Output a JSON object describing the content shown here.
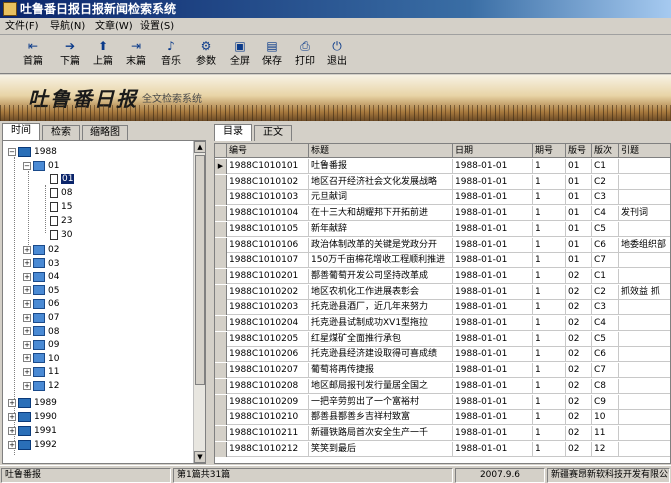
{
  "window": {
    "title": "吐鲁番日报日报新闻检索系统"
  },
  "menu": [
    "文件(F)",
    "导航(N)",
    "文章(W)",
    "设置(S)"
  ],
  "toolbar": [
    {
      "label": "首篇",
      "icon": "first-article-icon",
      "glyph": "⇤"
    },
    {
      "label": "下篇",
      "icon": "next-article-icon",
      "glyph": "➔"
    },
    {
      "label": "上篇",
      "icon": "prev-article-icon",
      "glyph": "⬆"
    },
    {
      "label": "末篇",
      "icon": "last-article-icon",
      "glyph": "⇥"
    },
    {
      "label": "音乐",
      "icon": "music-note-icon",
      "glyph": "♪"
    },
    {
      "label": "参数",
      "icon": "settings-icon",
      "glyph": "⚙"
    },
    {
      "label": "全屏",
      "icon": "fullscreen-icon",
      "glyph": "▣"
    },
    {
      "label": "保存",
      "icon": "save-disk-icon",
      "glyph": "▤"
    },
    {
      "label": "打印",
      "icon": "printer-icon",
      "glyph": "⎙"
    },
    {
      "label": "退出",
      "icon": "exit-icon",
      "glyph": "⏻"
    }
  ],
  "banner": {
    "logo": "吐鲁番日报",
    "subtitle": "全文检索系统"
  },
  "left_tabs": [
    "时间",
    "检索",
    "缩略图"
  ],
  "tree": {
    "year_open": "1988",
    "month_open": "01",
    "days": [
      "01",
      "08",
      "15",
      "23",
      "30"
    ],
    "months": [
      "02",
      "03",
      "04",
      "05",
      "06",
      "07",
      "08",
      "09",
      "10",
      "11",
      "12"
    ],
    "years": [
      "1989",
      "1990",
      "1991",
      "1992"
    ]
  },
  "right_tabs": [
    "目录",
    "正文"
  ],
  "grid": {
    "columns": [
      "编号",
      "标题",
      "日期",
      "期号",
      "版号",
      "版次",
      "引题"
    ],
    "rows": [
      [
        "1988C1010101",
        "吐鲁番报",
        "1988-01-01",
        "1",
        "01",
        "C1",
        ""
      ],
      [
        "1988C1010102",
        "地区召开经济社会文化发展战略",
        "1988-01-01",
        "1",
        "01",
        "C2",
        ""
      ],
      [
        "1988C1010103",
        "元旦献词",
        "1988-01-01",
        "1",
        "01",
        "C3",
        ""
      ],
      [
        "1988C1010104",
        "在十三大和胡耀邦下开拓前进",
        "1988-01-01",
        "1",
        "01",
        "C4",
        "发刊词"
      ],
      [
        "1988C1010105",
        "新年献辞",
        "1988-01-01",
        "1",
        "01",
        "C5",
        ""
      ],
      [
        "1988C1010106",
        "政治体制改革的关键是党政分开",
        "1988-01-01",
        "1",
        "01",
        "C6",
        "地委组织部"
      ],
      [
        "1988C1010107",
        "150万千亩棉花增收工程顺利推进",
        "1988-01-01",
        "1",
        "01",
        "C7",
        ""
      ],
      [
        "1988C1010201",
        "鄯善葡萄开发公司坚持改革成",
        "1988-01-01",
        "1",
        "02",
        "C1",
        ""
      ],
      [
        "1988C1010202",
        "地区农机化工作进展表彰会",
        "1988-01-01",
        "1",
        "02",
        "C2",
        "抓效益 抓"
      ],
      [
        "1988C1010203",
        "托克逊县酒厂，近几年来努力",
        "1988-01-01",
        "1",
        "02",
        "C3",
        ""
      ],
      [
        "1988C1010204",
        "托克逊县试制成功XV1型拖拉",
        "1988-01-01",
        "1",
        "02",
        "C4",
        ""
      ],
      [
        "1988C1010205",
        "红星煤矿全面推行承包",
        "1988-01-01",
        "1",
        "02",
        "C5",
        ""
      ],
      [
        "1988C1010206",
        "托克逊县经济建设取得可喜成绩",
        "1988-01-01",
        "1",
        "02",
        "C6",
        ""
      ],
      [
        "1988C1010207",
        "葡萄将再传捷报",
        "1988-01-01",
        "1",
        "02",
        "C7",
        ""
      ],
      [
        "1988C1010208",
        "地区邮局报刊发行量居全国之",
        "1988-01-01",
        "1",
        "02",
        "C8",
        ""
      ],
      [
        "1988C1010209",
        "一把辛劳剪出了一个富裕村",
        "1988-01-01",
        "1",
        "02",
        "C9",
        ""
      ],
      [
        "1988C1010210",
        "鄯善县鄯善乡吉祥村致富",
        "1988-01-01",
        "1",
        "02",
        "10",
        ""
      ],
      [
        "1988C1010211",
        "新疆铁路局首次安全生产一千",
        "1988-01-01",
        "1",
        "02",
        "11",
        ""
      ],
      [
        "1988C1010212",
        "笑笑到最后",
        "1988-01-01",
        "1",
        "02",
        "12",
        ""
      ]
    ]
  },
  "status": {
    "current_title": "吐鲁番报",
    "page_info": "第1篇共31篇",
    "date": "2007.9.6",
    "publisher": "新疆赛昂新软科技开发有限公司"
  }
}
